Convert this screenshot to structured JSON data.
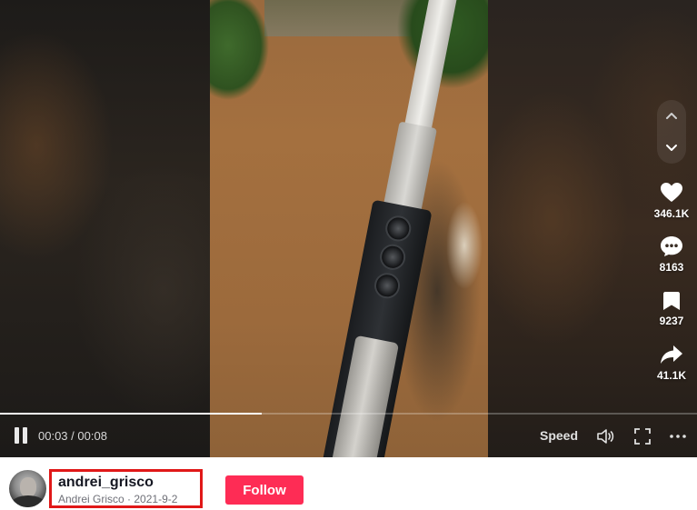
{
  "player": {
    "current_time": "00:03",
    "total_time": "00:08",
    "time_separator": " / ",
    "progress_fraction": 0.375,
    "speed_label": "Speed",
    "icons": {
      "pause": "pause-icon",
      "volume": "volume-icon",
      "fullscreen": "fullscreen-icon",
      "more": "more-icon",
      "prev": "chevron-up-icon",
      "next": "chevron-down-icon"
    }
  },
  "actions": {
    "likes": "346.1K",
    "comments": "8163",
    "saves": "9237",
    "shares": "41.1K"
  },
  "author": {
    "username": "andrei_grisco",
    "display_name": "Andrei Grisco",
    "separator": " · ",
    "date": "2021-9-2",
    "follow_label": "Follow",
    "highlight_color": "#e01818"
  },
  "colors": {
    "follow": "#fe2c55",
    "username": "#161823",
    "subtext": "#6f7078"
  }
}
